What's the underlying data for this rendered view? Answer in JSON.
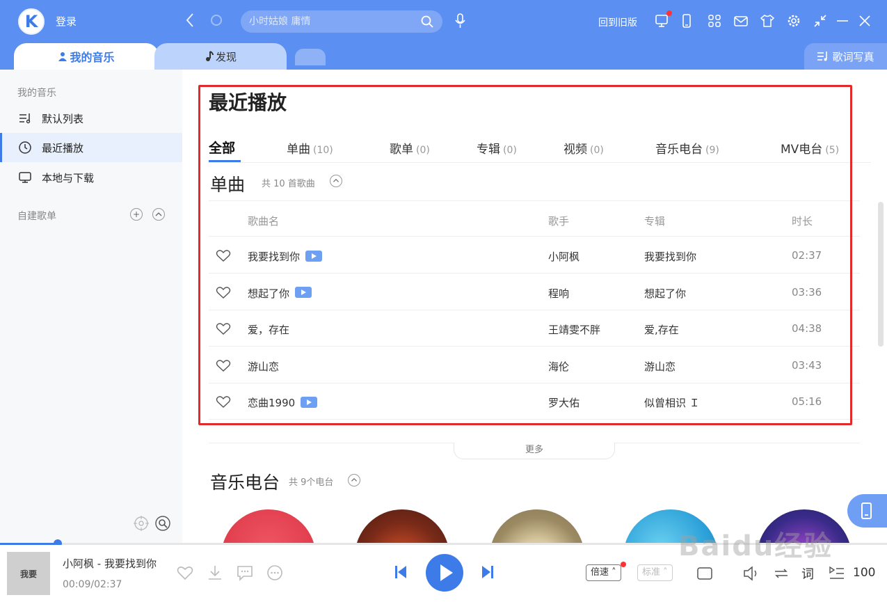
{
  "header": {
    "logo_letter": "K",
    "login_label": "登录",
    "search_placeholder": "小时姑娘 庸情",
    "old_version_label": "回到旧版"
  },
  "tabs": {
    "my_music": "我的音乐",
    "discover": "发现",
    "lyrics": "歌词写真"
  },
  "sidebar": {
    "heading": "我的音乐",
    "items": [
      {
        "label": "默认列表"
      },
      {
        "label": "最近播放"
      },
      {
        "label": "本地与下载"
      }
    ],
    "custom_heading": "自建歌单"
  },
  "main": {
    "title": "最近播放",
    "categories": [
      {
        "label": "全部",
        "count": ""
      },
      {
        "label": "单曲",
        "count": "(10)"
      },
      {
        "label": "歌单",
        "count": "(0)"
      },
      {
        "label": "专辑",
        "count": "(0)"
      },
      {
        "label": "视频",
        "count": "(0)"
      },
      {
        "label": "音乐电台",
        "count": "(9)"
      },
      {
        "label": "MV电台",
        "count": "(5)"
      }
    ],
    "singles": {
      "title": "单曲",
      "subtitle": "共 10 首歌曲",
      "columns": {
        "name": "歌曲名",
        "singer": "歌手",
        "album": "专辑",
        "duration": "时长"
      },
      "rows": [
        {
          "name": "我要找到你",
          "singer": "小阿枫",
          "album": "我要找到你",
          "duration": "02:37",
          "mv": true
        },
        {
          "name": "想起了你",
          "singer": "程响",
          "album": "想起了你",
          "duration": "03:36",
          "mv": true
        },
        {
          "name": "爱，存在",
          "singer": "王靖雯不胖",
          "album": "爱,存在",
          "duration": "04:38",
          "mv": false
        },
        {
          "name": "游山恋",
          "singer": "海伦",
          "album": "游山恋",
          "duration": "03:43",
          "mv": false
        },
        {
          "name": "恋曲1990",
          "singer": "罗大佑",
          "album": "似曾相识 Ｉ",
          "duration": "05:16",
          "mv": true
        }
      ],
      "more_label": "更多"
    },
    "radio": {
      "title": "音乐电台",
      "subtitle": "共 9个电台"
    }
  },
  "player": {
    "cover_text": "我要",
    "now_playing": "小阿枫 - 我要找到你",
    "time": "00:09/02:37",
    "progress": 0.065,
    "speed_label": "倍速",
    "quality_label": "标准",
    "lyrics_label": "词",
    "volume": "100"
  },
  "colors": {
    "accent": "#3d7be8",
    "header_bg": "#5b8ff2",
    "highlight": "#e12b2b"
  },
  "watermark": "Baidu经验"
}
